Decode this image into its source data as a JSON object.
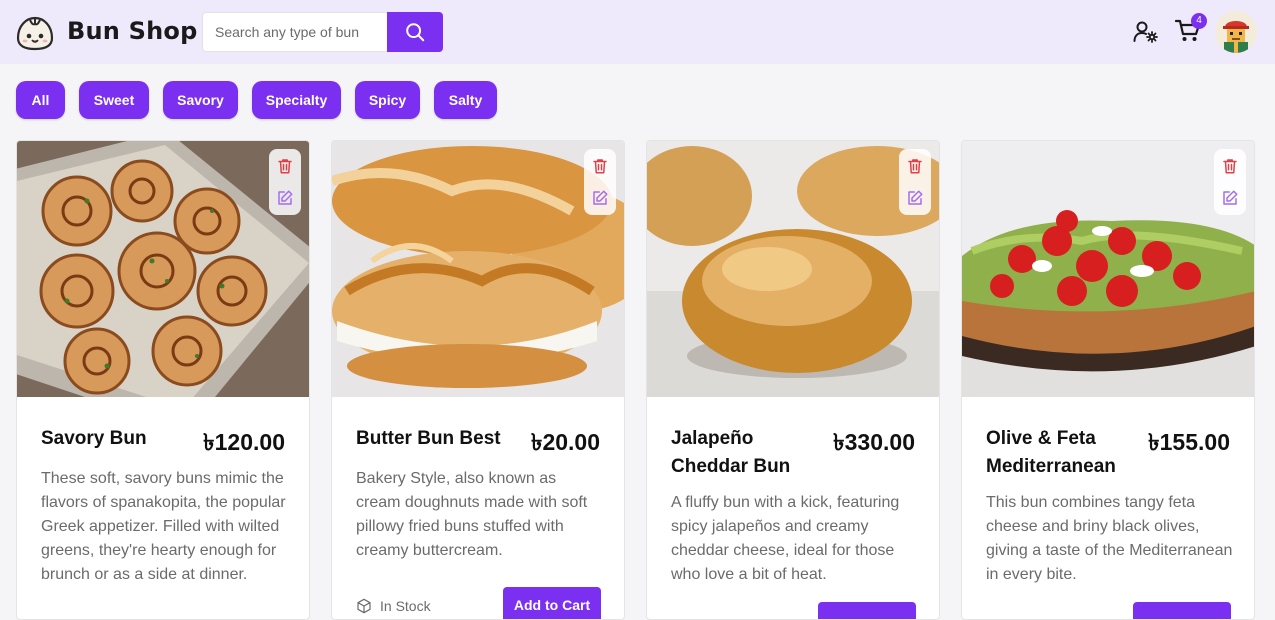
{
  "header": {
    "brand": "Bun Shop",
    "search": {
      "placeholder": "Search any type of bun",
      "value": ""
    },
    "cart_count": "4",
    "accent": "#7b2ff0"
  },
  "filters": [
    "All",
    "Sweet",
    "Savory",
    "Specialty",
    "Spicy",
    "Salty"
  ],
  "products": [
    {
      "title": "Savory Bun",
      "currency": "৳",
      "price": "120.00",
      "description": "These soft, savory buns mimic the flavors of spanakopita, the popular Greek appetizer. Filled with wilted greens, they're hearty enough for brunch or as a side at dinner.",
      "stock": "",
      "cart_label": ""
    },
    {
      "title": "Butter Bun Best",
      "currency": "৳",
      "price": "20.00",
      "description": "Bakery Style, also known as cream doughnuts made with soft pillowy fried buns stuffed with creamy buttercream.",
      "stock": "In Stock",
      "cart_label": "Add to Cart"
    },
    {
      "title": "Jalapeño Cheddar Bun",
      "currency": "৳",
      "price": "330.00",
      "description": "A fluffy bun with a kick, featuring spicy jalapeños and creamy cheddar cheese, ideal for those who love a bit of heat.",
      "stock": "",
      "cart_label": ""
    },
    {
      "title": "Olive & Feta Mediterranean",
      "currency": "৳",
      "price": "155.00",
      "description": "This bun combines tangy feta cheese and briny black olives, giving a taste of the Mediterranean in every bite.",
      "stock": "",
      "cart_label": ""
    }
  ]
}
